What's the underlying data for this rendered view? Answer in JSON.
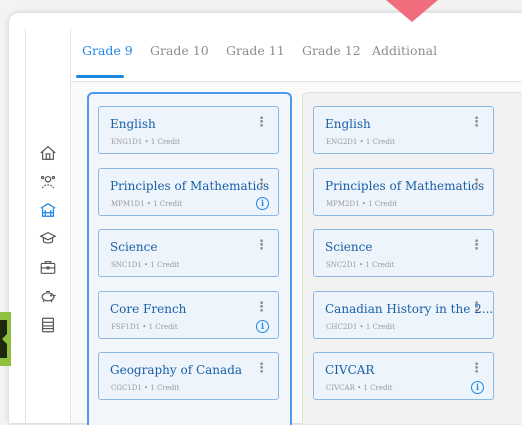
{
  "tabs": [
    {
      "label": "Grade 9",
      "active": true
    },
    {
      "label": "Grade 10",
      "active": false
    },
    {
      "label": "Grade 11",
      "active": false
    },
    {
      "label": "Grade 12",
      "active": false
    },
    {
      "label": "Additional",
      "active": false
    }
  ],
  "sidebar": {
    "icons": [
      "home-icon",
      "people-icon",
      "school-building-icon",
      "graduation-cap-icon",
      "briefcase-icon",
      "piggy-bank-icon",
      "notebook-icon"
    ]
  },
  "columns": [
    {
      "cards": [
        {
          "title": "English",
          "subtitle": "ENG1D1 • 1 Credit",
          "info": false
        },
        {
          "title": "Principles of Mathematics",
          "subtitle": "MPM1D1 • 1 Credit",
          "info": true
        },
        {
          "title": "Science",
          "subtitle": "SNC1D1 • 1 Credit",
          "info": false
        },
        {
          "title": "Core French",
          "subtitle": "FSF1D1 • 1 Credit",
          "info": true
        },
        {
          "title": "Geography of Canada",
          "subtitle": "CGC1D1 • 1 Credit",
          "info": false
        }
      ]
    },
    {
      "cards": [
        {
          "title": "English",
          "subtitle": "ENG2D1 • 1 Credit",
          "info": false
        },
        {
          "title": "Principles of Mathematics",
          "subtitle": "MPM2D1 • 1 Credit",
          "info": false
        },
        {
          "title": "Science",
          "subtitle": "SNC2D1 • 1 Credit",
          "info": false
        },
        {
          "title": "Canadian History in the 2...",
          "subtitle": "CHC2D1 • 1 Credit",
          "info": false
        },
        {
          "title": "CIVCAR",
          "subtitle": "CIVCAR • 1 Credit",
          "info": true
        }
      ]
    }
  ],
  "colors": {
    "accent": "#1e88e5",
    "pointer": "#f06d7d",
    "green_tab": "#8fc13e"
  }
}
